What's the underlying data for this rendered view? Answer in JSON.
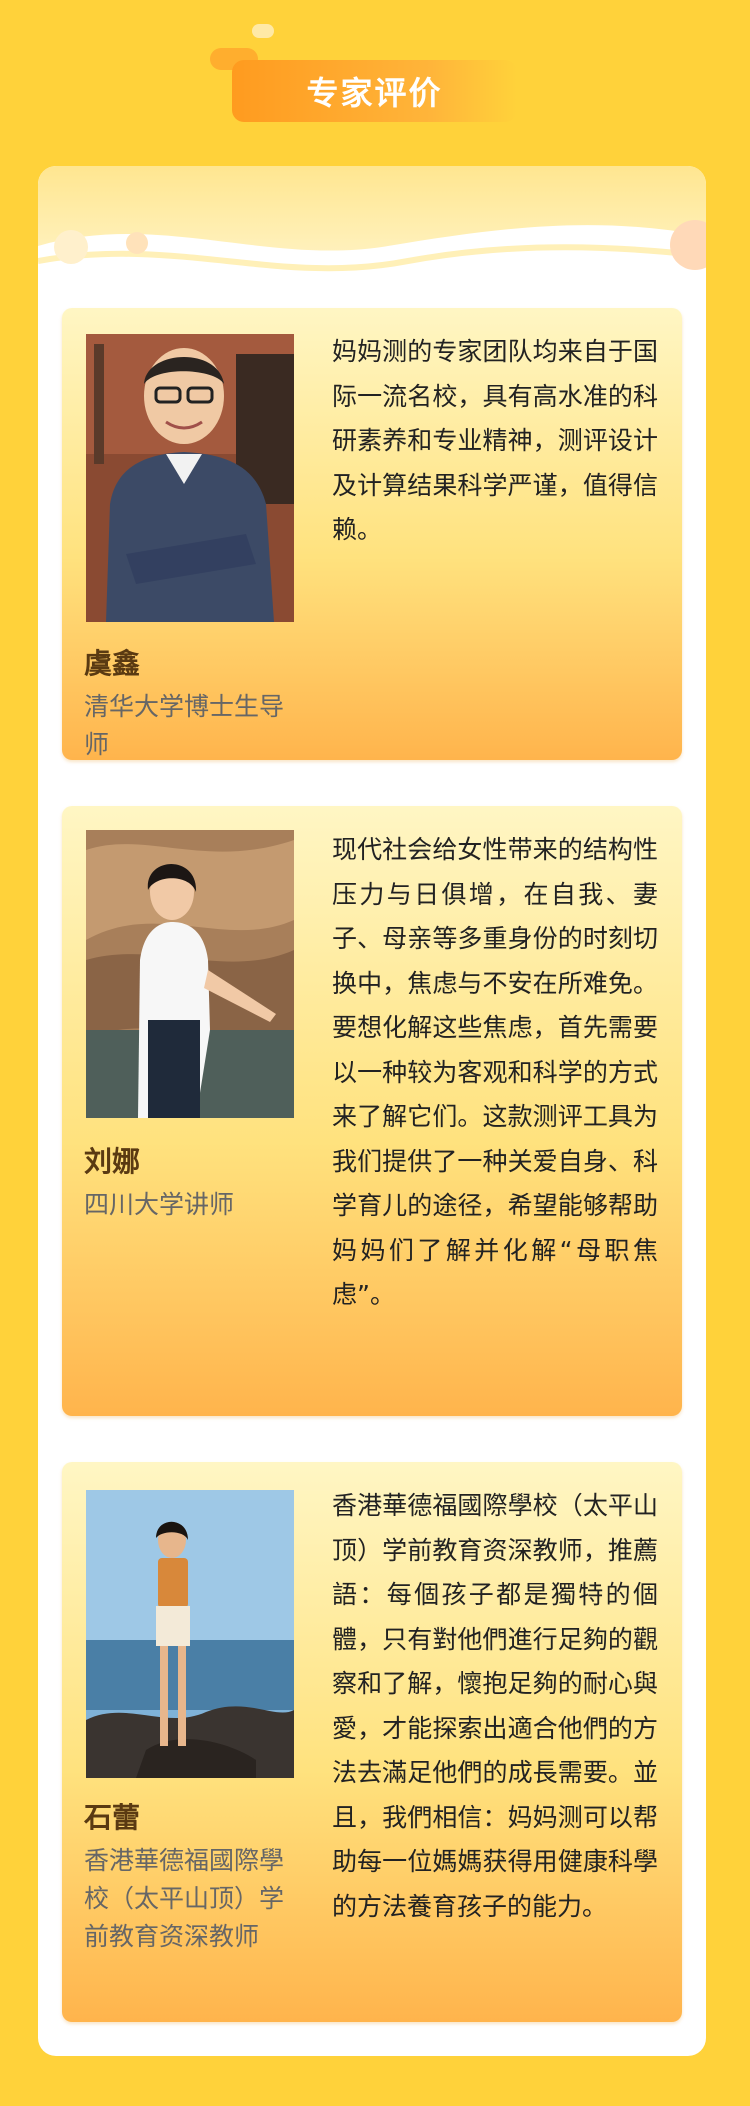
{
  "section_title": "专家评价",
  "experts": [
    {
      "name": "虞鑫",
      "role": "清华大学博士生导师",
      "quote": "妈妈测的专家团队均来自于国际一流名校，具有高水准的科研素养和专业精神，测评设计及计算结果科学严谨，值得信赖。"
    },
    {
      "name": "刘娜",
      "role": "四川大学讲师",
      "quote": "现代社会给女性带来的结构性压力与日俱增，在自我、妻子、母亲等多重身份的时刻切换中，焦虑与不安在所难免。要想化解这些焦虑，首先需要以一种较为客观和科学的方式来了解它们。这款测评工具为我们提供了一种关爱自身、科学育儿的途径，希望能够帮助妈妈们了解并化解“母职焦虑”。"
    },
    {
      "name": "石蕾",
      "role": "香港華德福國際學校（太平山顶）学前教育资深教师",
      "quote": "香港華德福國際學校（太平山顶）学前教育资深教师，推薦語：每個孩子都是獨特的個體，只有對他們進行足夠的觀察和了解，懷抱足夠的耐心與愛，才能探索出適合他們的方法去滿足他們的成長需要。並且，我們相信：妈妈测可以帮助每一位媽媽获得用健康科學的方法養育孩子的能力。"
    }
  ],
  "colors": {
    "background": "#FFD23A",
    "title_gradient_start": "#FF9B1F",
    "card_top": "#FFF6C4",
    "card_bottom": "#FFB44C",
    "name_color": "#5a3a12"
  }
}
